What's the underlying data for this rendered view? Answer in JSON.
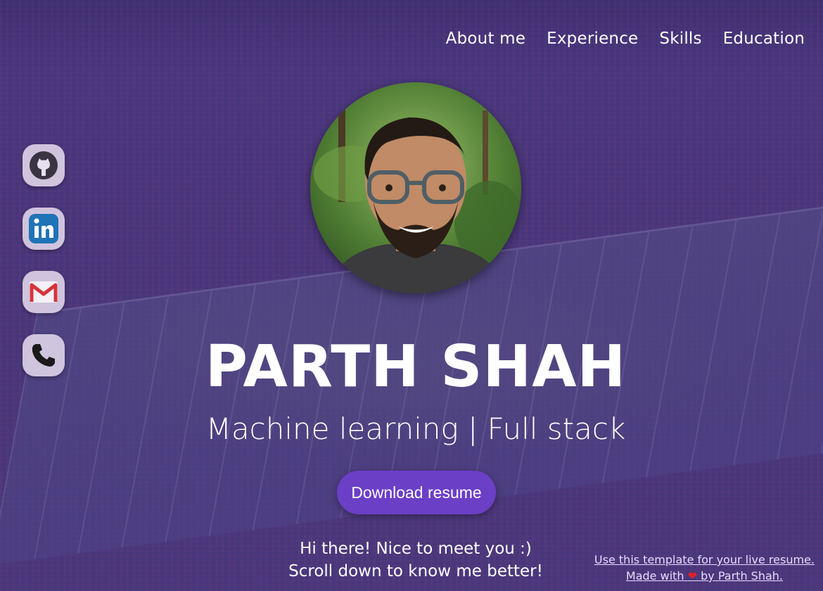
{
  "nav": {
    "items": [
      {
        "label": "About me"
      },
      {
        "label": "Experience"
      },
      {
        "label": "Skills"
      },
      {
        "label": "Education"
      }
    ]
  },
  "social": [
    {
      "icon": "github-icon"
    },
    {
      "icon": "linkedin-icon"
    },
    {
      "icon": "gmail-icon"
    },
    {
      "icon": "phone-icon"
    }
  ],
  "hero": {
    "name": "PARTH SHAH",
    "subtitle": "Machine learning | Full stack",
    "download_label": "Download resume",
    "greeting_line1": "Hi there! Nice to meet you :)",
    "greeting_line2": "Scroll down to know me better!"
  },
  "footer": {
    "template_link": "Use this template for your live resume.",
    "made_with": "Made with",
    "heart": "❤",
    "by": "by Parth Shah."
  },
  "colors": {
    "accent": "#6b3fc6",
    "overlay": "#4a3a7c",
    "heart": "#e0202a"
  }
}
